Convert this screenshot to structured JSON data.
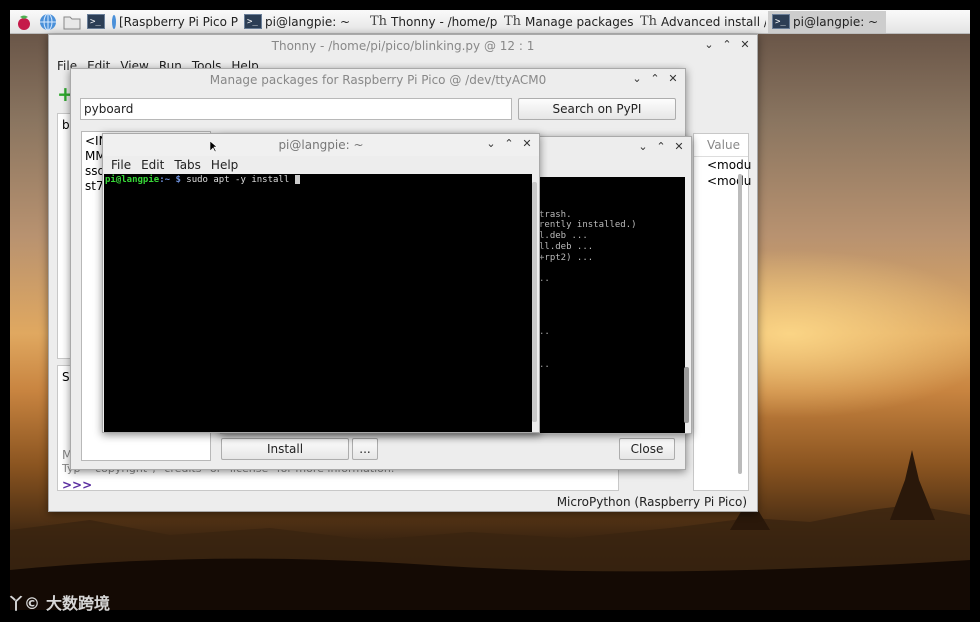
{
  "taskbar": {
    "icons": [
      "raspberry-icon",
      "browser-icon",
      "folder-icon",
      "terminal-icon"
    ],
    "tasks": [
      {
        "label": "[Raspberry Pi Pico Py...",
        "icon": "chromium-icon"
      },
      {
        "label": "pi@langpie: ~",
        "icon": "terminal-icon"
      },
      {
        "label": "Thonny  -  /home/pi/...",
        "icon": "thonny-icon"
      },
      {
        "label": "Manage packages for...",
        "icon": "thonny-icon"
      },
      {
        "label": "Advanced install / up...",
        "icon": "thonny-icon"
      },
      {
        "label": "pi@langpie: ~",
        "icon": "terminal-icon"
      }
    ]
  },
  "thonny": {
    "title": "Thonny  -  /home/pi/pico/blinking.py  @  12 : 1",
    "menu": [
      "File",
      "Edit",
      "View",
      "Run",
      "Tools",
      "Help"
    ],
    "editor_tab": "bl",
    "variables_header": "Value",
    "variables_values": [
      "<modu",
      "<modu"
    ],
    "shell_tab": "Sh",
    "shell_fragments": [
      "M",
      "Typ",
      "\"copyright\", \"credits\" or \"license\" for more information."
    ],
    "shell_prompt": ">>>",
    "status": "MicroPython (Raspberry Pi Pico)"
  },
  "manage": {
    "title": "Manage packages for Raspberry Pi Pico @ /dev/ttyACM0",
    "search_value": "pyboard",
    "search_button": "Search on PyPI",
    "packages": [
      "<INS",
      "MM",
      "ssd",
      "st7"
    ],
    "install_button": "Install",
    "more_button": "...",
    "close_button": "Close"
  },
  "behind_terminal": {
    "lines": [
      "trash.",
      "rently installed.)",
      "l.deb ...",
      "",
      "ll.deb ...",
      "+rpt2) ...",
      "",
      "..",
      "",
      "",
      "",
      "",
      "..",
      "",
      "",
      ".."
    ]
  },
  "terminal": {
    "title": "pi@langpie: ~",
    "menu": [
      "File",
      "Edit",
      "Tabs",
      "Help"
    ],
    "prompt_user": "pi@langpie",
    "prompt_path": ":~ $",
    "command": " sudo apt -y install "
  },
  "watermark": {
    "logo": "丫©",
    "text": "大数跨境"
  }
}
